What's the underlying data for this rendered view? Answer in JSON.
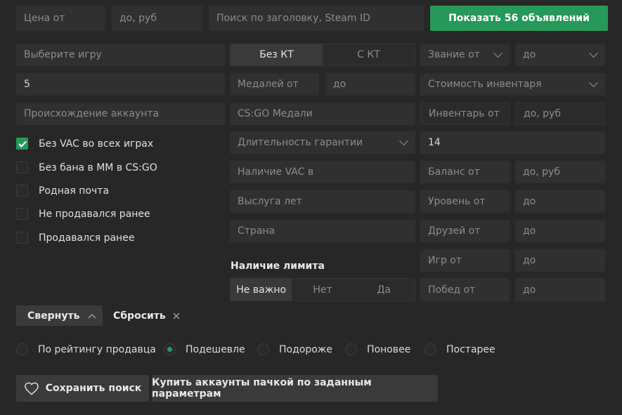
{
  "top": {
    "price_from": "Цена от",
    "price_to": "до, руб",
    "search": "Поиск по заголовку, Steam ID",
    "show_button": "Показать 56 объявлений"
  },
  "col1": {
    "game": "Выберите игру",
    "number_value": "5",
    "origin": "Происхождение аккаунта",
    "checkboxes": [
      {
        "label": "Без VAC во всех играх",
        "checked": true
      },
      {
        "label": "Без бана в ММ в CS:GO",
        "checked": false
      },
      {
        "label": "Родная почта",
        "checked": false
      },
      {
        "label": "Не продавался ранее",
        "checked": false
      },
      {
        "label": "Продавался ранее",
        "checked": false
      }
    ]
  },
  "col2": {
    "kt_options": [
      "Без КТ",
      "С КТ"
    ],
    "kt_selected": "Без КТ",
    "medals_from": "Медалей от",
    "medals_to": "до",
    "csgo_medals": "CS:GO Медали",
    "warranty": "Длительность гарантии",
    "vac_in": "Наличие VAC в",
    "years": "Выслуга лет",
    "country": "Страна",
    "limit_title": "Наличие лимита",
    "limit_options": [
      "Не важно",
      "Нет",
      "Да"
    ],
    "limit_selected": "Не важно"
  },
  "col3": {
    "rank_from": "Звание от",
    "rank_to": "до",
    "inventory_cost": "Стоимость инвентаря",
    "inventory_from": "Инвентарь от",
    "inventory_to": "до, руб",
    "warranty_value": "14",
    "balance_from": "Баланс от",
    "balance_to": "до, руб",
    "level_from": "Уровень от",
    "level_to": "до",
    "friends_from": "Друзей от",
    "friends_to": "до",
    "games_from": "Игр от",
    "games_to": "до",
    "wins_from": "Побед от",
    "wins_to": "до"
  },
  "actions": {
    "collapse": "Свернуть",
    "reset": "Сбросить"
  },
  "sort": {
    "options": [
      "По рейтингу продавца",
      "Подешевле",
      "Подороже",
      "Поновее",
      "Постарее"
    ],
    "selected": "Подешевле"
  },
  "bottom": {
    "save_search": "Сохранить поиск",
    "buy_batch": "Купить аккаунты пачкой по заданным параметрам"
  },
  "colors": {
    "accent": "#26995a",
    "background": "#272727",
    "field": "#303030"
  }
}
